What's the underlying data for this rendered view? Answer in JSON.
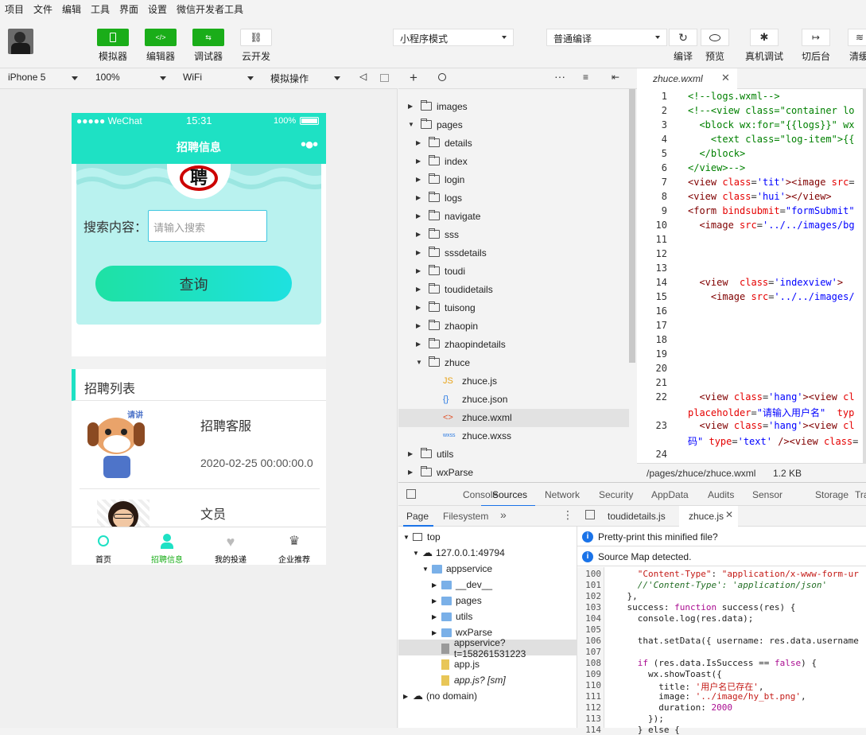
{
  "menu": [
    "项目",
    "文件",
    "编辑",
    "工具",
    "界面",
    "设置",
    "微信开发者工具"
  ],
  "toolbar": {
    "buttons": [
      {
        "label": "模拟器"
      },
      {
        "label": "编辑器"
      },
      {
        "label": "调试器"
      },
      {
        "label": "云开发"
      }
    ],
    "mode_select": "小程序模式",
    "compile_select": "普通编译",
    "actions": [
      {
        "label": "编译"
      },
      {
        "label": "预览"
      },
      {
        "label": "真机调试"
      },
      {
        "label": "切后台"
      },
      {
        "label": "清缓"
      }
    ]
  },
  "simbar": {
    "device": "iPhone 5",
    "zoom": "100%",
    "network": "WiFi",
    "op": "模拟操作"
  },
  "phone": {
    "status": {
      "carrier": "●●●●● WeChat",
      "time": "15:31",
      "battery": "100%"
    },
    "title": "招聘信息",
    "badge": "聘",
    "search_label": "搜索内容：",
    "search_placeholder": "请输入搜索",
    "query_button": "查询",
    "list_title": "招聘列表",
    "jobs": [
      {
        "title": "招聘客服",
        "date": "2020-02-25 00:00:00.0"
      },
      {
        "title": "文员",
        "date": ""
      }
    ],
    "tabs": [
      {
        "label": "首页"
      },
      {
        "label": "招聘信息"
      },
      {
        "label": "我的投递"
      },
      {
        "label": "企业推荐"
      }
    ],
    "accent": "#1ee1c4"
  },
  "filetree": {
    "items": [
      {
        "name": "images",
        "level": 0,
        "open": false
      },
      {
        "name": "pages",
        "level": 0,
        "open": true
      },
      {
        "name": "details",
        "level": 1,
        "open": false
      },
      {
        "name": "index",
        "level": 1,
        "open": false
      },
      {
        "name": "login",
        "level": 1,
        "open": false
      },
      {
        "name": "logs",
        "level": 1,
        "open": false
      },
      {
        "name": "navigate",
        "level": 1,
        "open": false
      },
      {
        "name": "sss",
        "level": 1,
        "open": false
      },
      {
        "name": "sssdetails",
        "level": 1,
        "open": false
      },
      {
        "name": "toudi",
        "level": 1,
        "open": false
      },
      {
        "name": "toudidetails",
        "level": 1,
        "open": false
      },
      {
        "name": "tuisong",
        "level": 1,
        "open": false
      },
      {
        "name": "zhaopin",
        "level": 1,
        "open": false
      },
      {
        "name": "zhaopindetails",
        "level": 1,
        "open": false
      },
      {
        "name": "zhuce",
        "level": 1,
        "open": true
      },
      {
        "name": "zhuce.js",
        "level": 2,
        "icon": "JS"
      },
      {
        "name": "zhuce.json",
        "level": 2,
        "icon": "{}"
      },
      {
        "name": "zhuce.wxml",
        "level": 2,
        "icon": "<>"
      },
      {
        "name": "zhuce.wxss",
        "level": 2,
        "icon": "wxss"
      },
      {
        "name": "utils",
        "level": 0,
        "open": false
      },
      {
        "name": "wxParse",
        "level": 0,
        "open": false
      }
    ]
  },
  "editor": {
    "tab": "zhuce.wxml",
    "path": "/pages/zhuce/zhuce.wxml",
    "size": "1.2 KB",
    "lines": [
      {
        "n": "1",
        "h": "<span class='cm'>&lt;!--logs.wxml--&gt;</span>"
      },
      {
        "n": "2",
        "h": "<span class='cm'>&lt;!--&lt;view class=\"container lo</span>"
      },
      {
        "n": "3",
        "h": "<span class='cm'>  &lt;block wx:for=\"{{logs}}\" wx</span>"
      },
      {
        "n": "4",
        "h": "<span class='cm'>    &lt;text class=\"log-item\"&gt;{{</span>"
      },
      {
        "n": "5",
        "h": "<span class='cm'>  &lt;/block&gt;</span>"
      },
      {
        "n": "6",
        "h": "<span class='cm'>&lt;/view&gt;--&gt;</span>"
      },
      {
        "n": "7",
        "h": "<span class='tg'>&lt;view</span> <span class='at'>class</span>=<span class='st'>'tit'</span><span class='tg'>&gt;&lt;image</span> <span class='at'>src</span>="
      },
      {
        "n": "8",
        "h": "<span class='tg'>&lt;view</span> <span class='at'>class</span>=<span class='st'>'hui'</span><span class='tg'>&gt;&lt;/view&gt;</span>"
      },
      {
        "n": "9",
        "h": "<span class='tg'>&lt;form</span> <span class='at'>bindsubmit</span>=<span class='st'>\"formSubmit\"</span>"
      },
      {
        "n": "10",
        "h": "  <span class='tg'>&lt;image</span> <span class='at'>src</span>=<span class='st'>'../../images/bg</span>"
      },
      {
        "n": "11",
        "h": ""
      },
      {
        "n": "12",
        "h": ""
      },
      {
        "n": "13",
        "h": ""
      },
      {
        "n": "14",
        "h": "  <span class='tg'>&lt;view</span>  <span class='at'>class</span>=<span class='st'>'indexview'</span><span class='tg'>&gt;</span>"
      },
      {
        "n": "15",
        "h": "    <span class='tg'>&lt;image</span> <span class='at'>src</span>=<span class='st'>'../../images/</span>"
      },
      {
        "n": "16",
        "h": ""
      },
      {
        "n": "17",
        "h": ""
      },
      {
        "n": "18",
        "h": ""
      },
      {
        "n": "19",
        "h": ""
      },
      {
        "n": "20",
        "h": ""
      },
      {
        "n": "21",
        "h": ""
      },
      {
        "n": "22",
        "h": "  <span class='tg'>&lt;view</span> <span class='at'>class</span>=<span class='st'>'hang'</span><span class='tg'>&gt;&lt;view</span> <span class='at'>cl</span>"
      },
      {
        "n": "",
        "h": "<span class='at'>placeholder</span>=<span class='st'>\"请输入用户名\"</span>  <span class='at'>typ</span>"
      },
      {
        "n": "23",
        "h": "  <span class='tg'>&lt;view</span> <span class='at'>class</span>=<span class='st'>'hang'</span><span class='tg'>&gt;&lt;view</span> <span class='at'>cl</span>"
      },
      {
        "n": "",
        "h": "<span class='st'>码\"</span> <span class='at'>type</span>=<span class='st'>'text'</span> <span class='tg'>/&gt;&lt;view</span> <span class='at'>class</span>="
      },
      {
        "n": "24",
        "h": ""
      }
    ]
  },
  "devtools": {
    "tabs": [
      "Console",
      "Sources",
      "Network",
      "Security",
      "AppData",
      "Audits",
      "Sensor",
      "Storage",
      "Trac"
    ],
    "active": "Sources",
    "left_tabs": [
      "Page",
      "Filesystem"
    ],
    "tree": [
      {
        "name": "top",
        "level": 0
      },
      {
        "name": "127.0.0.1:49794",
        "level": 1
      },
      {
        "name": "appservice",
        "level": 2
      },
      {
        "name": "__dev__",
        "level": 3
      },
      {
        "name": "pages",
        "level": 3
      },
      {
        "name": "utils",
        "level": 3
      },
      {
        "name": "wxParse",
        "level": 3
      },
      {
        "name": "appservice?t=158261531223",
        "level": 3
      },
      {
        "name": "app.js",
        "level": 3
      },
      {
        "name": "app.js? [sm]",
        "level": 3
      },
      {
        "name": "(no domain)",
        "level": 0
      }
    ],
    "file_tabs": [
      "toudidetails.js",
      "zhuce.js"
    ],
    "info1": "Pretty-print this minified file?",
    "info2": "Source Map detected.",
    "code": [
      {
        "n": "100",
        "h": "      <span class='sg'>\"Content-Type\"</span>: <span class='sg'>\"application/x-www-form-ur</span>"
      },
      {
        "n": "101",
        "h": "      <span class='cc'>//'Content-Type': 'application/json'</span>"
      },
      {
        "n": "102",
        "h": "    },"
      },
      {
        "n": "103",
        "h": "    success: <span class='kw'>function</span> success(res) {"
      },
      {
        "n": "104",
        "h": "      console.log(res.data);"
      },
      {
        "n": "105",
        "h": ""
      },
      {
        "n": "106",
        "h": "      that.setData({ username: res.data.username"
      },
      {
        "n": "107",
        "h": ""
      },
      {
        "n": "108",
        "h": "      <span class='kw'>if</span> (res.data.IsSuccess == <span class='kw'>false</span>) {"
      },
      {
        "n": "109",
        "h": "        wx.showToast({"
      },
      {
        "n": "110",
        "h": "          title: <span class='sg'>'用户名已存在'</span>,"
      },
      {
        "n": "111",
        "h": "          image: <span class='sg'>'../image/hy_bt.png'</span>,"
      },
      {
        "n": "112",
        "h": "          duration: <span class='kw'>2000</span>"
      },
      {
        "n": "113",
        "h": "        });"
      },
      {
        "n": "114",
        "h": "      } else {"
      }
    ]
  }
}
